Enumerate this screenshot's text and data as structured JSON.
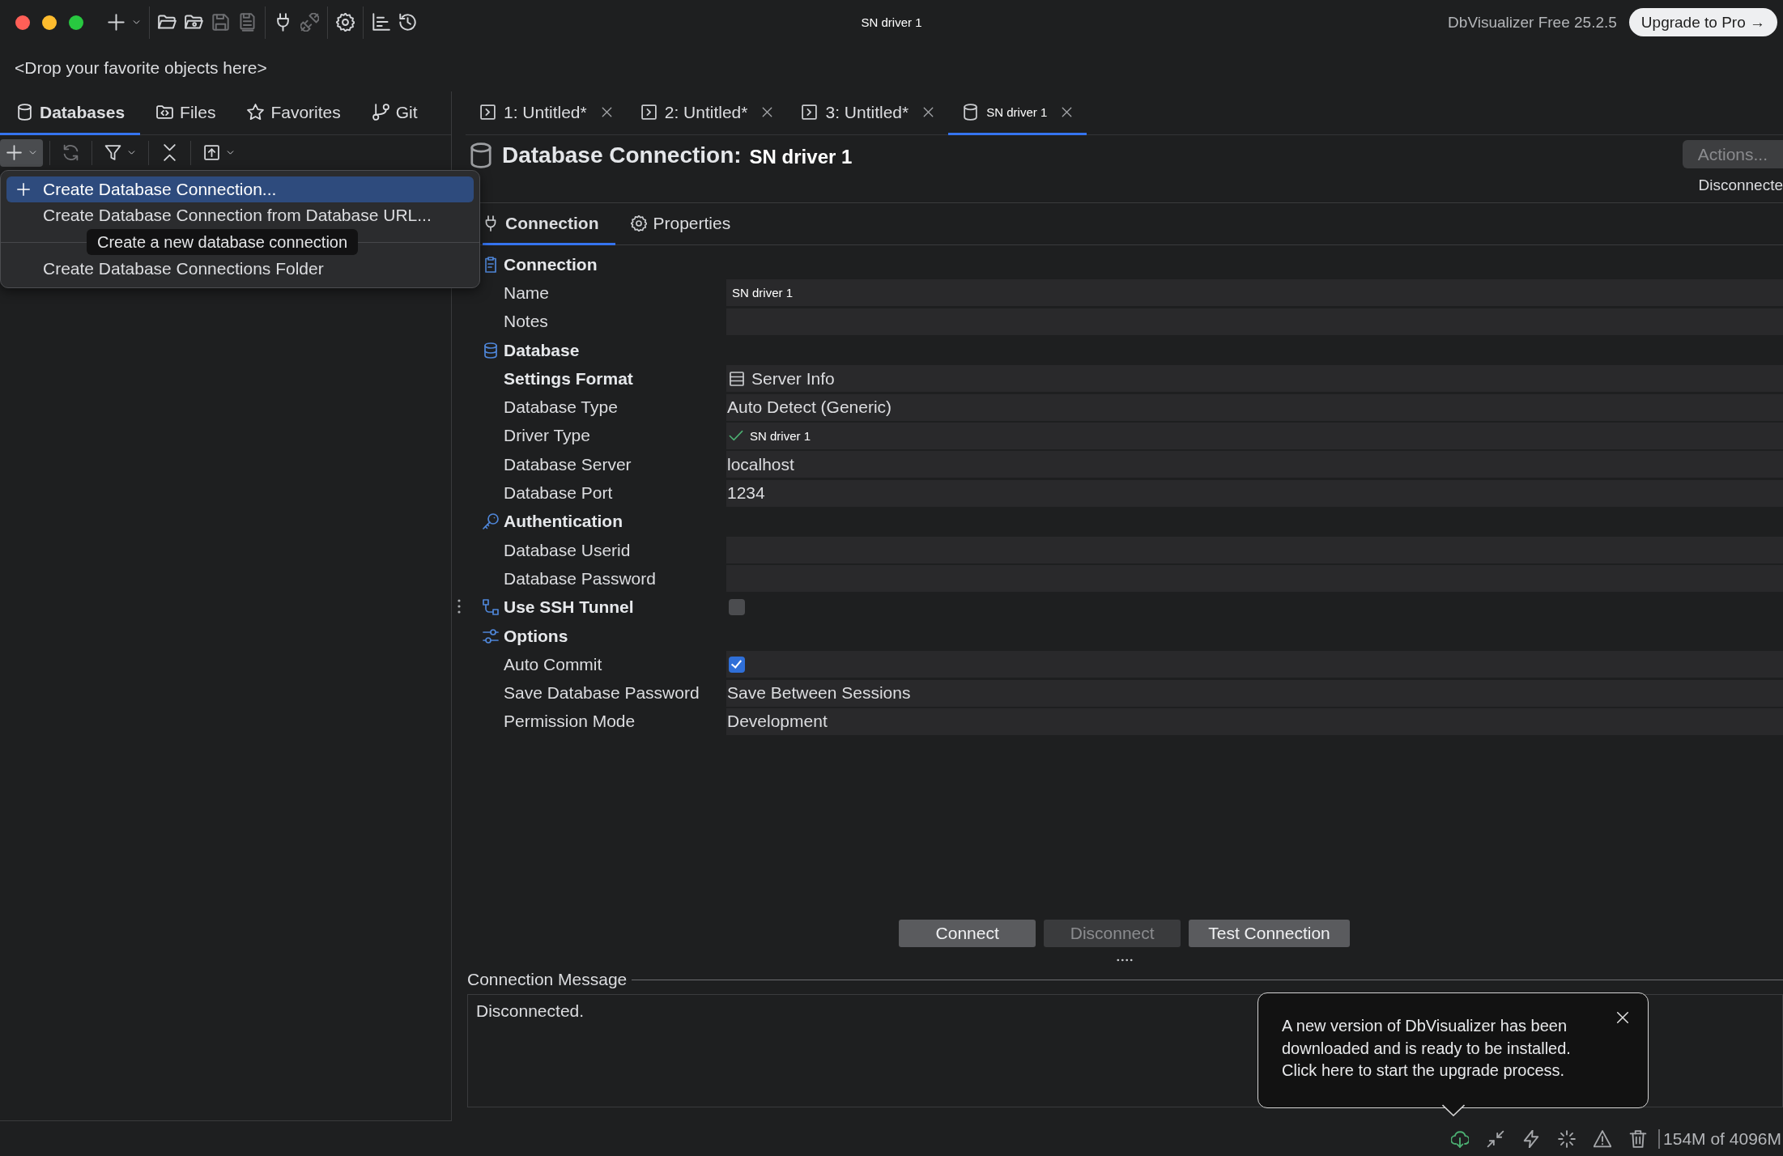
{
  "window": {
    "title": "SN driver 1"
  },
  "toolbar": [
    [
      {
        "kind": "new",
        "dropdown": true,
        "disabled": false
      }
    ],
    [
      {
        "kind": "open",
        "dropdown": false,
        "disabled": false
      },
      {
        "kind": "open-recent",
        "dropdown": false,
        "disabled": false
      },
      {
        "kind": "save",
        "dropdown": false,
        "disabled": true
      },
      {
        "kind": "save-all",
        "dropdown": false,
        "disabled": true
      }
    ],
    [
      {
        "kind": "connect",
        "dropdown": false,
        "disabled": false
      },
      {
        "kind": "disconnect",
        "dropdown": false,
        "disabled": true
      }
    ],
    [
      {
        "kind": "settings",
        "dropdown": false,
        "disabled": false
      }
    ],
    [
      {
        "kind": "chart",
        "dropdown": false,
        "disabled": false
      },
      {
        "kind": "history",
        "dropdown": false,
        "disabled": false
      }
    ]
  ],
  "product": {
    "version": "DbVisualizer Free 25.2.5",
    "upgrade_button": "Upgrade to Pro →"
  },
  "favorites_bar": {
    "hint": "<Drop your favorite objects here>"
  },
  "side_tabs": [
    {
      "label": "Databases",
      "selected": true
    },
    {
      "label": "Files",
      "selected": false
    },
    {
      "label": "Favorites",
      "selected": false
    },
    {
      "label": "Git",
      "selected": false
    }
  ],
  "side_toolbar": [
    {
      "kind": "add",
      "dropdown": true,
      "disabled": false,
      "pressed": true
    },
    {
      "kind": "refresh",
      "dropdown": false,
      "disabled": true,
      "pressed": false
    },
    {
      "kind": "filter",
      "dropdown": true,
      "disabled": false,
      "pressed": false
    },
    {
      "kind": "collapse",
      "dropdown": false,
      "disabled": false,
      "pressed": false
    },
    {
      "kind": "export",
      "dropdown": true,
      "disabled": false,
      "pressed": false
    }
  ],
  "create_menu": {
    "groups": [
      [
        {
          "label": "Create Database Connection...",
          "icon": true,
          "selected": true
        },
        {
          "label": "Create Database Connection from Database URL...",
          "icon": false,
          "selected": false
        }
      ],
      [
        {
          "label": "Create Database Connections Folder",
          "icon": false,
          "selected": false
        }
      ]
    ],
    "tooltip": "Create a new database connection"
  },
  "editor_tabs": [
    {
      "label": "1: Untitled*",
      "kind": "sql",
      "selected": false
    },
    {
      "label": "2: Untitled*",
      "kind": "sql",
      "selected": false
    },
    {
      "label": "3: Untitled*",
      "kind": "sql",
      "selected": false
    },
    {
      "label": "SN driver 1",
      "kind": "connection",
      "selected": true
    }
  ],
  "editor": {
    "title": "Database Connection:",
    "name": "SN driver 1",
    "actions_button": {
      "label": "Actions...",
      "disabled": true
    },
    "status": "Disconnecte",
    "subtabs": [
      {
        "label": "Connection",
        "selected": true
      },
      {
        "label": "Properties",
        "selected": false
      }
    ],
    "form": [
      {
        "title": "Connection",
        "kind": "group",
        "rows": [
          {
            "label": "Name",
            "kind": "input",
            "value": "SN driver 1"
          },
          {
            "label": "Notes",
            "kind": "input"
          }
        ]
      },
      {
        "title": "Database",
        "kind": "group",
        "rows": [
          {
            "label": "Settings Format",
            "kind": "format",
            "value": "Server Info"
          },
          {
            "label": "Database Type",
            "kind": "value",
            "value": "Auto Detect (Generic)"
          },
          {
            "label": "Driver Type",
            "kind": "driver",
            "value": "SN driver 1"
          },
          {
            "label": "Database Server",
            "kind": "value",
            "value": "localhost"
          },
          {
            "label": "Database Port",
            "kind": "value",
            "value": "1234"
          }
        ]
      },
      {
        "title": "Authentication",
        "kind": "group",
        "rows": [
          {
            "label": "Database Userid",
            "kind": "input"
          },
          {
            "label": "Database Password",
            "kind": "input"
          }
        ]
      },
      {
        "title": "Use SSH Tunnel",
        "kind": "toggle",
        "checked": false
      },
      {
        "title": "Options",
        "kind": "group",
        "rows": [
          {
            "label": "Auto Commit",
            "kind": "checkbox",
            "checked": true
          },
          {
            "label": "Save Database Password",
            "kind": "value",
            "value": "Save Between Sessions"
          },
          {
            "label": "Permission Mode",
            "kind": "value",
            "value": "Development"
          }
        ]
      }
    ],
    "buttons": [
      {
        "label": "Connect",
        "disabled": false
      },
      {
        "label": "Disconnect",
        "disabled": true
      },
      {
        "label": "Test Connection",
        "disabled": false
      }
    ],
    "message": {
      "legend": "Connection Message",
      "text": "Disconnected."
    }
  },
  "notification": {
    "text": "A new version of DbVisualizer has been downloaded and is ready to be installed. Click here to start the upgrade process."
  },
  "status_bar": {
    "icons": [
      {
        "kind": "update",
        "active": true
      },
      {
        "kind": "compress",
        "active": false
      },
      {
        "kind": "events",
        "active": false
      },
      {
        "kind": "jobs",
        "active": false
      },
      {
        "kind": "warnings",
        "active": false
      },
      {
        "kind": "trash",
        "active": false
      }
    ],
    "memory": "154M of 4096M"
  }
}
